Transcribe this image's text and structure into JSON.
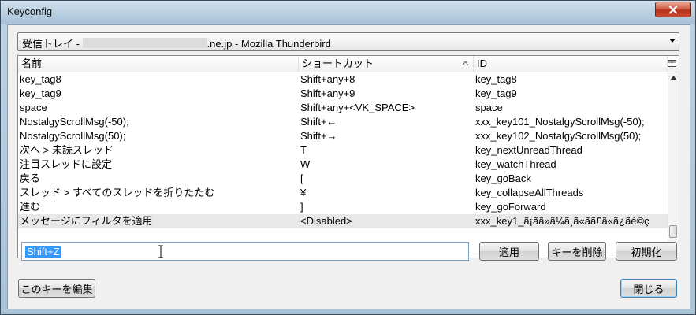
{
  "window": {
    "title": "Keyconfig"
  },
  "account_select": {
    "prefix": "受信トレイ - ",
    "suffix": ".ne.jp - Mozilla Thunderbird"
  },
  "tree": {
    "columns": [
      "名前",
      "ショートカット",
      "ID"
    ],
    "sorted_column": "ショートカット",
    "rows": [
      {
        "name": "key_tag8",
        "shortcut": "Shift+any+8",
        "id": "key_tag8"
      },
      {
        "name": "key_tag9",
        "shortcut": "Shift+any+9",
        "id": "key_tag9"
      },
      {
        "name": "space",
        "shortcut": "Shift+any+<VK_SPACE>",
        "id": "space"
      },
      {
        "name": "NostalgyScrollMsg(-50);",
        "shortcut": "Shift+←",
        "id": "xxx_key101_NostalgyScrollMsg(-50);"
      },
      {
        "name": "NostalgyScrollMsg(50);",
        "shortcut": "Shift+→",
        "id": "xxx_key102_NostalgyScrollMsg(50);"
      },
      {
        "name": "次へ > 未読スレッド",
        "shortcut": "T",
        "id": "key_nextUnreadThread"
      },
      {
        "name": "注目スレッドに設定",
        "shortcut": "W",
        "id": "key_watchThread"
      },
      {
        "name": "戻る",
        "shortcut": "[",
        "id": "key_goBack"
      },
      {
        "name": "スレッド > すべてのスレッドを折りたたむ",
        "shortcut": "¥",
        "id": "key_collapseAllThreads"
      },
      {
        "name": "進む",
        "shortcut": "]",
        "id": "key_goForward"
      },
      {
        "name": "メッセージにフィルタを適用",
        "shortcut": "<Disabled>",
        "id": "xxx_key1_ã¡ãã»ã¼ã¸ã«ãã£ã«ã¿ãé©ç",
        "selected": true
      }
    ]
  },
  "key_input": {
    "value": "Shift+Z"
  },
  "buttons": {
    "apply": "適用",
    "delete_key": "キーを削除",
    "reset": "初期化",
    "edit_key": "このキーを編集",
    "close": "閉じる"
  },
  "icons": {
    "close": "close-icon",
    "dropdown": "chevron-down-icon",
    "sort": "sort-ascending-icon",
    "column_picker": "column-picker-icon",
    "scroll_up": "scroll-up-icon",
    "scroll_down": "scroll-down-icon",
    "cursor": "text-cursor-icon"
  },
  "colors": {
    "selection": "#3399ff",
    "title_bar": "#b6cde0",
    "close_button": "#c84a32",
    "selected_row": "#e8e8e8"
  }
}
